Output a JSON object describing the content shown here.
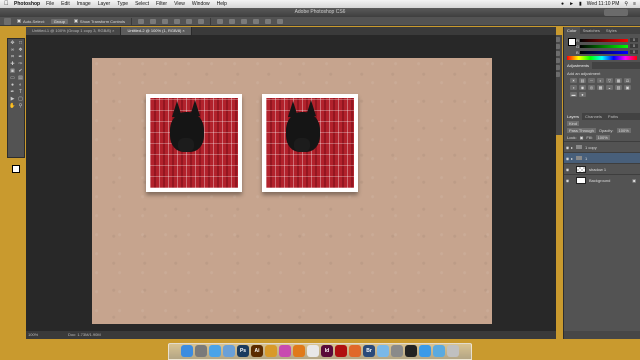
{
  "menubar": {
    "app_name": "Photoshop",
    "items": [
      "File",
      "Edit",
      "Image",
      "Layer",
      "Type",
      "Select",
      "Filter",
      "View",
      "Window",
      "Help"
    ],
    "clock": "Wed 11:10 PM"
  },
  "window": {
    "title": "Adobe Photoshop CS6"
  },
  "options": {
    "auto_select_label": "Auto-Select:",
    "auto_select_value": "Group",
    "transform_label": "Show Transform Controls"
  },
  "tabs": [
    {
      "label": "Untitled-1 @ 100% (Group 1 copy 3, RGB/8) ×",
      "active": false
    },
    {
      "label": "Untitled-2 @ 100% (1, RGB/8) ×",
      "active": true
    }
  ],
  "status": {
    "zoom": "100%",
    "doc": "Doc: 1.73M/1.90M"
  },
  "panels": {
    "color_tabs": [
      "Color",
      "Swatches",
      "Styles"
    ],
    "color_rows": [
      {
        "label": "R",
        "value": "0",
        "color": "#e84c4c"
      },
      {
        "label": "G",
        "value": "0",
        "color": "#4ce84c"
      },
      {
        "label": "B",
        "value": "0",
        "color": "#4c7ce8"
      }
    ],
    "adjustments_tab": "Adjustments",
    "adjustments_title": "Add an adjustment",
    "layers_tabs": [
      "Layers",
      "Channels",
      "Paths"
    ],
    "kind_label": "Kind",
    "blend_mode": "Pass Through",
    "opacity_label": "Opacity:",
    "opacity_value": "100%",
    "lock_label": "Lock:",
    "fill_label": "Fill:",
    "fill_value": "100%",
    "layers": [
      {
        "name": "1 copy",
        "kind": "group",
        "selected": false
      },
      {
        "name": "1",
        "kind": "group",
        "selected": true
      },
      {
        "name": "shadow 1",
        "kind": "pattern",
        "selected": false
      },
      {
        "name": "Background",
        "kind": "background",
        "selected": false
      }
    ]
  },
  "dock": {
    "icons": [
      {
        "name": "finder-icon",
        "color": "#3c8ce0",
        "glyph": ""
      },
      {
        "name": "launchpad-icon",
        "color": "#7a7a7a",
        "glyph": ""
      },
      {
        "name": "safari-icon",
        "color": "#4aa3e8",
        "glyph": ""
      },
      {
        "name": "mail-icon",
        "color": "#6aa0d8",
        "glyph": ""
      },
      {
        "name": "photoshop-icon",
        "color": "#1b3b5e",
        "glyph": "Ps"
      },
      {
        "name": "illustrator-icon",
        "color": "#5a2a00",
        "glyph": "Ai"
      },
      {
        "name": "photos-icon",
        "color": "#d89a2a",
        "glyph": ""
      },
      {
        "name": "itunes-icon",
        "color": "#c84ab0",
        "glyph": ""
      },
      {
        "name": "ibooks-icon",
        "color": "#e07a1a",
        "glyph": ""
      },
      {
        "name": "calendar-icon",
        "color": "#e8e8e8",
        "glyph": ""
      },
      {
        "name": "indesign-icon",
        "color": "#5a0a3a",
        "glyph": "Id"
      },
      {
        "name": "acrobat-icon",
        "color": "#b01010",
        "glyph": ""
      },
      {
        "name": "firefox-icon",
        "color": "#e0682a",
        "glyph": ""
      },
      {
        "name": "bridge-icon",
        "color": "#2a4a7a",
        "glyph": "Br"
      },
      {
        "name": "preview-icon",
        "color": "#7ab8e8",
        "glyph": ""
      },
      {
        "name": "system-preferences-icon",
        "color": "#8a8a8a",
        "glyph": ""
      },
      {
        "name": "terminal-icon",
        "color": "#222222",
        "glyph": ""
      },
      {
        "name": "app-store-icon",
        "color": "#3a9ae8",
        "glyph": ""
      },
      {
        "name": "folder-icon",
        "color": "#5aaae0",
        "glyph": ""
      },
      {
        "name": "trash-icon",
        "color": "#c0c0c0",
        "glyph": ""
      }
    ]
  },
  "colors": {
    "canvas": "#c6a48e",
    "desktop": "#c99a2e",
    "ps_panel": "#535353",
    "selection": "#485f7a"
  }
}
